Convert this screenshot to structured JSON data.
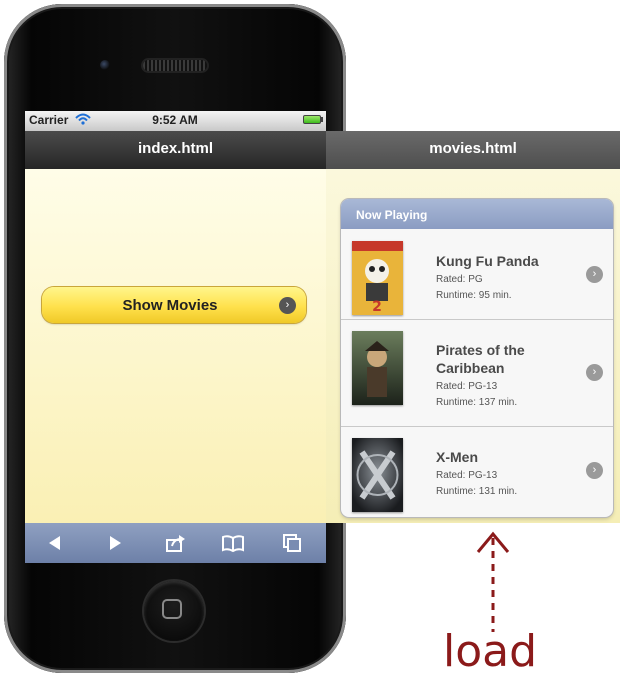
{
  "status_bar": {
    "carrier": "Carrier",
    "time": "9:52 AM"
  },
  "left_page": {
    "title": "index.html",
    "show_movies_button": "Show Movies"
  },
  "right_page": {
    "title": "movies.html",
    "list_header": "Now Playing",
    "movies": [
      {
        "title_line1": "Kung Fu Panda",
        "title_line2": "",
        "rated": "Rated: PG",
        "runtime": "Runtime: 95 min."
      },
      {
        "title_line1": "Pirates of the",
        "title_line2": "Caribbean",
        "rated": "Rated: PG-13",
        "runtime": "Runtime: 137 min."
      },
      {
        "title_line1": "X-Men",
        "title_line2": "",
        "rated": "Rated: PG-13",
        "runtime": "Runtime: 131 min."
      }
    ]
  },
  "annotation": {
    "label": "load"
  },
  "colors": {
    "accent_arrow": "#8b1a1a",
    "button_yellow": "#ffe14c",
    "toolbar_blue": "#7a8cb2"
  },
  "icons": [
    "back-arrow-icon",
    "forward-arrow-icon",
    "share-icon",
    "bookmarks-icon",
    "tabs-icon",
    "wifi-icon",
    "battery-icon",
    "chevron-right-icon"
  ]
}
